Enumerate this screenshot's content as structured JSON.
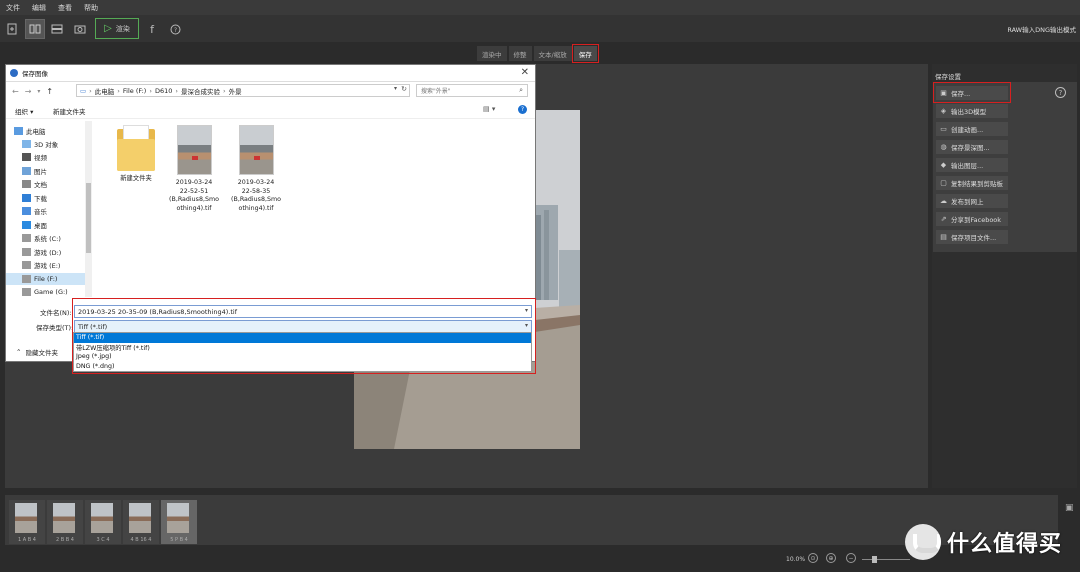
{
  "menubar": {
    "items": [
      "文件",
      "编辑",
      "查看",
      "帮助"
    ]
  },
  "toolbar": {
    "render_label": "渲染",
    "mode_text": "RAW输入DNG输出模式"
  },
  "tabs": [
    {
      "label": "渲染中"
    },
    {
      "label": "修整"
    },
    {
      "label": "文本/缩放"
    },
    {
      "label": "保存"
    }
  ],
  "right_panel": {
    "title": "保存设置",
    "buttons": [
      {
        "label": "保存...",
        "icon": "floppy-icon"
      },
      {
        "label": "输出3D模型",
        "icon": "cube-icon"
      },
      {
        "label": "创建动画...",
        "icon": "film-icon"
      },
      {
        "label": "保存景深图...",
        "icon": "depth-icon"
      },
      {
        "label": "输出图层...",
        "icon": "layers-icon"
      },
      {
        "label": "复制结果到剪贴板",
        "icon": "clipboard-icon"
      },
      {
        "label": "发布到网上",
        "icon": "cloud-icon"
      },
      {
        "label": "分享到Facebook",
        "icon": "share-icon"
      },
      {
        "label": "保存项目文件...",
        "icon": "file-icon"
      }
    ]
  },
  "dialog": {
    "title": "保存图像",
    "path": [
      "此电脑",
      "File (F:)",
      "D610",
      "景深合成实验",
      "外景"
    ],
    "search_placeholder": "搜索\"外景\"",
    "organize_label": "组织 ▾",
    "newfolder_label": "新建文件夹",
    "nav_items": [
      {
        "label": "此电脑",
        "icon": "pc-icon"
      },
      {
        "label": "3D 对象",
        "icon": "3d-icon"
      },
      {
        "label": "视频",
        "icon": "video-icon"
      },
      {
        "label": "图片",
        "icon": "picture-icon"
      },
      {
        "label": "文档",
        "icon": "document-icon"
      },
      {
        "label": "下载",
        "icon": "download-icon"
      },
      {
        "label": "音乐",
        "icon": "music-icon"
      },
      {
        "label": "桌面",
        "icon": "desktop-icon"
      },
      {
        "label": "系统 (C:)",
        "icon": "drive-icon"
      },
      {
        "label": "游戏 (D:)",
        "icon": "drive-icon"
      },
      {
        "label": "游戏 (E:)",
        "icon": "drive-icon"
      },
      {
        "label": "File (F:)",
        "icon": "drive-icon"
      },
      {
        "label": "Game (G:)",
        "icon": "drive-icon"
      }
    ],
    "files": [
      {
        "name": "新建文件夹",
        "type": "folder"
      },
      {
        "name_lines": [
          "2019-03-24",
          "22-52-51",
          "(B,Radius8,Smo",
          "othing4).tif"
        ],
        "type": "tif"
      },
      {
        "name_lines": [
          "2019-03-24",
          "22-58-35",
          "(B,Radius8,Smo",
          "othing4).tif"
        ],
        "type": "tif"
      }
    ],
    "filename_label": "文件名(N):",
    "filename_value": "2019-03-25 20-35-09 (B,Radius8,Smoothing4).tif",
    "filetype_label": "保存类型(T):",
    "filetype_value": "Tiff (*.tif)",
    "filetype_options": [
      "Tiff (*.tif)",
      "带LZW压缩项的Tiff (*.tif)",
      "Jpeg (*.jpg)",
      "DNG (*.dng)"
    ],
    "hide_folders_label": "隐藏文件夹"
  },
  "filmstrip": {
    "thumbs": [
      {
        "caption": "1  A B 4"
      },
      {
        "caption": "2  B B 4"
      },
      {
        "caption": "3    C 4"
      },
      {
        "caption": "4 B 16 4"
      },
      {
        "caption": "5  P B 4"
      }
    ]
  },
  "status": {
    "zoom": "10.0%"
  },
  "watermark": {
    "text": "什么值得买"
  },
  "colors": {
    "highlight": "#d62020",
    "accent": "#0078d7"
  }
}
